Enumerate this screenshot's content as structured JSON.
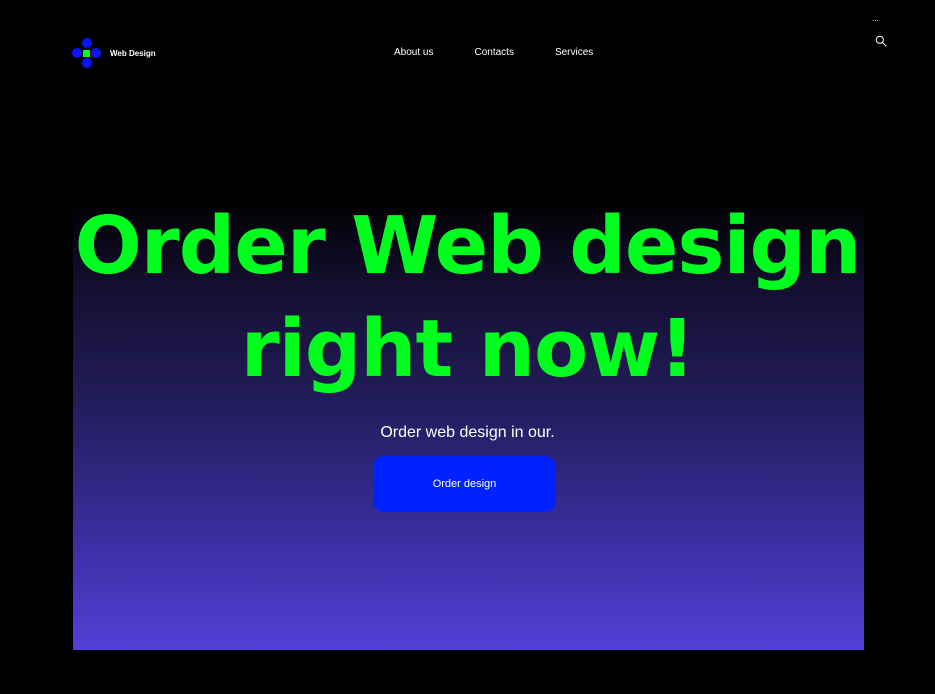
{
  "colors": {
    "background": "#000000",
    "accent_green": "#00ff1e",
    "button_blue": "#0022ff",
    "logo_blue": "#0a12ff",
    "gradient_end": "#5340d8"
  },
  "header": {
    "logo": {
      "icon": "flower-dots-icon",
      "text": "Web Design"
    },
    "nav": [
      {
        "label": "About us"
      },
      {
        "label": "Contacts"
      },
      {
        "label": "Services"
      }
    ],
    "more_icon": "...",
    "search_icon": "search-icon"
  },
  "hero": {
    "headline_line1": "Order Web design",
    "headline_line2": "right now!",
    "subtitle": "Order web design in our.",
    "cta_label": "Order design"
  }
}
